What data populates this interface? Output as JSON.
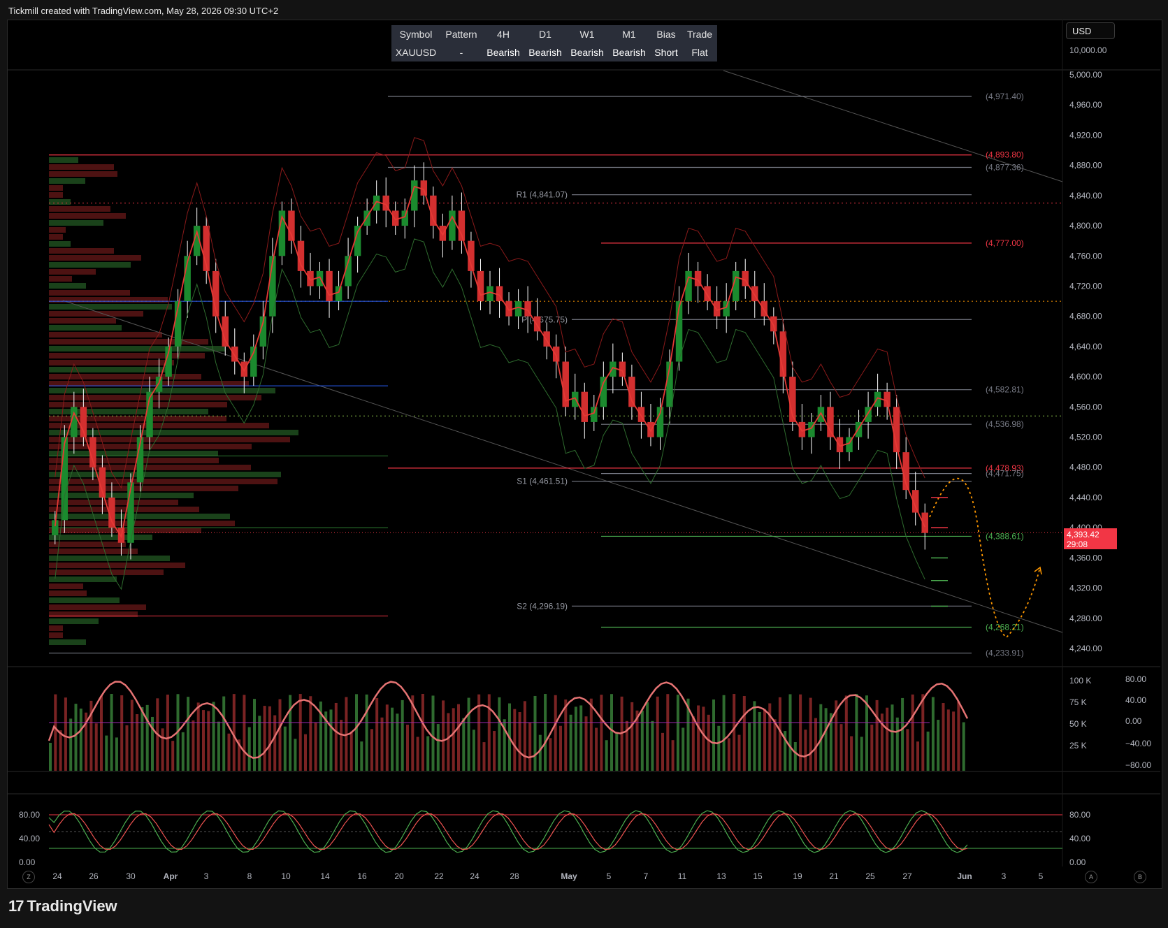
{
  "header": {
    "attribution": "Tickmill created with TradingView.com, May 28, 2026 09:30 UTC+2"
  },
  "footer": {
    "brand": "TradingView",
    "brand_logo": "17"
  },
  "currency_button": "USD",
  "bias_table": {
    "headers": [
      "Symbol",
      "Pattern",
      "4H",
      "D1",
      "W1",
      "M1",
      "Bias",
      "Trade"
    ],
    "values": [
      "XAUUSD",
      "-",
      "Bearish",
      "Bearish",
      "Bearish",
      "Bearish",
      "Short",
      "Flat"
    ]
  },
  "current_price": {
    "price": "4,393.42",
    "countdown": "29:08"
  },
  "chart_buttons": {
    "left": "Z",
    "auto": "A",
    "log": "B"
  },
  "chart_data": {
    "type": "candlestick",
    "symbol": "XAUUSD",
    "price_axis": {
      "ticks": [
        "10,000.00",
        "5,000.00",
        "4,960.00",
        "4,920.00",
        "4,880.00",
        "4,840.00",
        "4,800.00",
        "4,760.00",
        "4,720.00",
        "4,680.00",
        "4,640.00",
        "4,600.00",
        "4,560.00",
        "4,520.00",
        "4,480.00",
        "4,440.00",
        "4,400.00",
        "4,360.00",
        "4,320.00",
        "4,280.00",
        "4,240.00"
      ],
      "range": [
        4225,
        5000
      ]
    },
    "x_axis": {
      "ticks": [
        "24",
        "26",
        "30",
        "Apr",
        "3",
        "8",
        "10",
        "14",
        "16",
        "20",
        "22",
        "24",
        "28",
        "May",
        "5",
        "7",
        "11",
        "13",
        "15",
        "19",
        "21",
        "25",
        "27",
        "Jun",
        "3",
        "5"
      ]
    },
    "levels": [
      {
        "label": "(4,971.40)",
        "value": 4971.4,
        "color": "#787b86"
      },
      {
        "label": "(4,893.80)",
        "value": 4893.8,
        "color": "#f23645"
      },
      {
        "label": "(4,877.36)",
        "value": 4877.36,
        "color": "#787b86"
      },
      {
        "label": "R1 (4,841.07)",
        "value": 4841.07,
        "color": "#787b86"
      },
      {
        "label": "(4,777.00)",
        "value": 4777.0,
        "color": "#f23645"
      },
      {
        "label": "P (4,675.75)",
        "value": 4675.75,
        "color": "#787b86"
      },
      {
        "label": "(4,582.81)",
        "value": 4582.81,
        "color": "#787b86"
      },
      {
        "label": "(4,536.98)",
        "value": 4536.98,
        "color": "#787b86"
      },
      {
        "label": "(4,478.93)",
        "value": 4478.93,
        "color": "#f23645"
      },
      {
        "label": "(4,471.75)",
        "value": 4471.75,
        "color": "#787b86"
      },
      {
        "label": "S1 (4,461.51)",
        "value": 4461.51,
        "color": "#787b86"
      },
      {
        "label": "(4,388.61)",
        "value": 4388.61,
        "color": "#4caf50"
      },
      {
        "label": "S2 (4,296.19)",
        "value": 4296.19,
        "color": "#787b86"
      },
      {
        "label": "(4,268.21)",
        "value": 4268.21,
        "color": "#4caf50"
      },
      {
        "label": "(4,233.91)",
        "value": 4233.91,
        "color": "#787b86"
      }
    ],
    "candles_close_approx": [
      4410,
      4520,
      4560,
      4520,
      4480,
      4440,
      4400,
      4380,
      4460,
      4520,
      4580,
      4600,
      4640,
      4700,
      4760,
      4800,
      4740,
      4680,
      4640,
      4620,
      4600,
      4640,
      4680,
      4760,
      4820,
      4780,
      4740,
      4720,
      4740,
      4700,
      4720,
      4760,
      4800,
      4820,
      4840,
      4820,
      4800,
      4820,
      4860,
      4840,
      4800,
      4780,
      4820,
      4780,
      4740,
      4700,
      4720,
      4700,
      4680,
      4700,
      4680,
      4660,
      4640,
      4620,
      4560,
      4580,
      4540,
      4560,
      4600,
      4620,
      4600,
      4560,
      4540,
      4520,
      4560,
      4620,
      4700,
      4740,
      4720,
      4700,
      4680,
      4700,
      4740,
      4720,
      4700,
      4680,
      4660,
      4600,
      4540,
      4520,
      4540,
      4560,
      4520,
      4500,
      4520,
      4540,
      4560,
      4580,
      4560,
      4500,
      4450,
      4420,
      4393
    ],
    "volume_axis": {
      "ticks": [
        "100 K",
        "75 K",
        "50 K",
        "25 K"
      ]
    },
    "oscillator_axis": {
      "ticks": [
        "80.00",
        "40.00",
        "0.00",
        "−40.00",
        "−80.00"
      ]
    },
    "stochastic_axis": {
      "ticks": [
        "80.00",
        "40.00",
        "0.00"
      ]
    },
    "bias": "Short"
  }
}
